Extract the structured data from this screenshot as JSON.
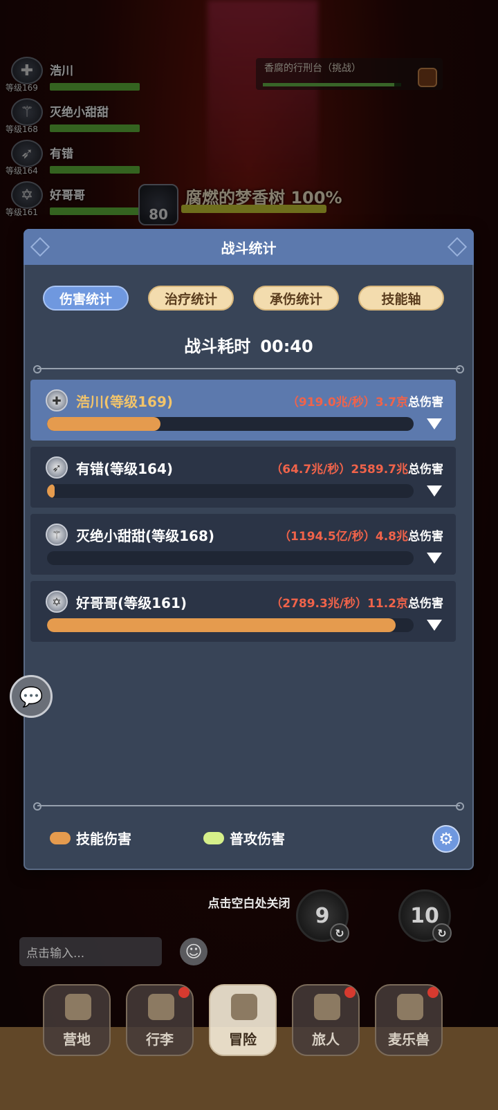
{
  "party": [
    {
      "name": "浩川",
      "level": "等级169",
      "icon": "cross-shield-icon",
      "hp": 1.0
    },
    {
      "name": "灭绝小甜甜",
      "level": "等级168",
      "icon": "staff-icon",
      "hp": 1.0
    },
    {
      "name": "有错",
      "level": "等级164",
      "icon": "bow-icon",
      "hp": 1.0
    },
    {
      "name": "好哥哥",
      "level": "等级161",
      "icon": "pentagram-icon",
      "hp": 1.0
    }
  ],
  "boss_challenge": {
    "title": "香腐的行刑台（挑战）",
    "hp": 0.95
  },
  "boss": {
    "name": "腐燃的梦香树 100%",
    "level": "80",
    "hp": 1.0
  },
  "modal": {
    "title": "战斗统计",
    "tabs": [
      "伤害统计",
      "治疗统计",
      "承伤统计",
      "技能轴"
    ],
    "active_tab": 0,
    "elapsed_label": "战斗耗时",
    "elapsed_value": "00:40",
    "rows": [
      {
        "name": "浩川(等级169)",
        "rate": "（919.0兆/秒）",
        "total": "3.7京",
        "total_label": "总伤害",
        "fill": 0.31,
        "selected": true,
        "icon": "cross-shield-icon"
      },
      {
        "name": "有错(等级164)",
        "rate": "（64.7兆/秒）",
        "total": "2589.7兆",
        "total_label": "总伤害",
        "fill": 0.02,
        "selected": false,
        "icon": "bow-icon"
      },
      {
        "name": "灭绝小甜甜(等级168)",
        "rate": "（1194.5亿/秒）",
        "total": "4.8兆",
        "total_label": "总伤害",
        "fill": 0.0,
        "selected": false,
        "icon": "staff-icon"
      },
      {
        "name": "好哥哥(等级161)",
        "rate": "（2789.3兆/秒）",
        "total": "11.2京",
        "total_label": "总伤害",
        "fill": 0.95,
        "selected": false,
        "icon": "pentagram-icon"
      }
    ],
    "legend": [
      {
        "label": "技能伤害",
        "color": "#e59b4e"
      },
      {
        "label": "普攻伤害",
        "color": "#d6f08a"
      }
    ]
  },
  "close_hint": "点击空白处关闭",
  "skills": [
    {
      "value": "9"
    },
    {
      "value": "10"
    }
  ],
  "chat": {
    "placeholder": "点击输入..."
  },
  "nav": [
    {
      "label": "营地",
      "badge": false,
      "active": false
    },
    {
      "label": "行李",
      "badge": true,
      "active": false
    },
    {
      "label": "冒险",
      "badge": false,
      "active": true
    },
    {
      "label": "旅人",
      "badge": true,
      "active": false
    },
    {
      "label": "麦乐兽",
      "badge": true,
      "active": false
    }
  ],
  "colors": {
    "accent": "#5c79ad",
    "bar": "#e59b4e",
    "damage_text": "#f0634a"
  }
}
